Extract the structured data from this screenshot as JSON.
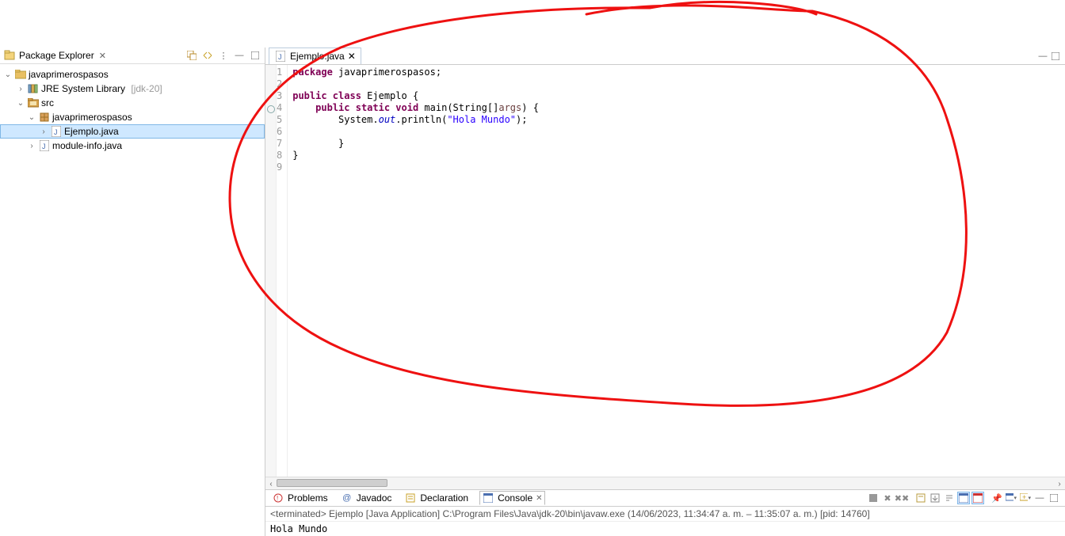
{
  "package_explorer": {
    "title": "Package Explorer",
    "tree": {
      "project": "javaprimerospasos",
      "jre": {
        "label": "JRE System Library",
        "suffix": "[jdk-20]"
      },
      "src": "src",
      "pkg": "javaprimerospasos",
      "file_selected": "Ejemplo.java",
      "module_info": "module-info.java"
    }
  },
  "editor": {
    "tab": "Ejemplo.java",
    "lines": [
      {
        "n": 1,
        "segs": [
          {
            "t": "package ",
            "c": "kw"
          },
          {
            "t": "javaprimerospasos;",
            "c": ""
          }
        ]
      },
      {
        "n": 2,
        "segs": [
          {
            "t": "",
            "c": ""
          }
        ]
      },
      {
        "n": 3,
        "segs": [
          {
            "t": "public class ",
            "c": "kw"
          },
          {
            "t": "Ejemplo {",
            "c": ""
          }
        ]
      },
      {
        "n": 4,
        "ann": true,
        "segs": [
          {
            "t": "    ",
            "c": ""
          },
          {
            "t": "public static void ",
            "c": "kw"
          },
          {
            "t": "main(String[]",
            "c": ""
          },
          {
            "t": "args",
            "c": "id"
          },
          {
            "t": ") {",
            "c": ""
          }
        ]
      },
      {
        "n": 5,
        "segs": [
          {
            "t": "        System.",
            "c": ""
          },
          {
            "t": "out",
            "c": "it"
          },
          {
            "t": ".println(",
            "c": ""
          },
          {
            "t": "\"Hola Mundo\"",
            "c": "str"
          },
          {
            "t": ");",
            "c": ""
          }
        ]
      },
      {
        "n": 6,
        "segs": [
          {
            "t": "",
            "c": ""
          }
        ]
      },
      {
        "n": 7,
        "segs": [
          {
            "t": "        }",
            "c": ""
          }
        ]
      },
      {
        "n": 8,
        "segs": [
          {
            "t": "}",
            "c": ""
          }
        ]
      },
      {
        "n": 9,
        "cur": true,
        "segs": [
          {
            "t": "",
            "c": ""
          }
        ]
      }
    ]
  },
  "bottom": {
    "problems": "Problems",
    "javadoc": "Javadoc",
    "declaration": "Declaration",
    "console": "Console",
    "console_header": "<terminated> Ejemplo [Java Application] C:\\Program Files\\Java\\jdk-20\\bin\\javaw.exe (14/06/2023, 11:34:47 a. m. – 11:35:07 a. m.) [pid: 14760]",
    "console_output": "Hola Mundo"
  }
}
